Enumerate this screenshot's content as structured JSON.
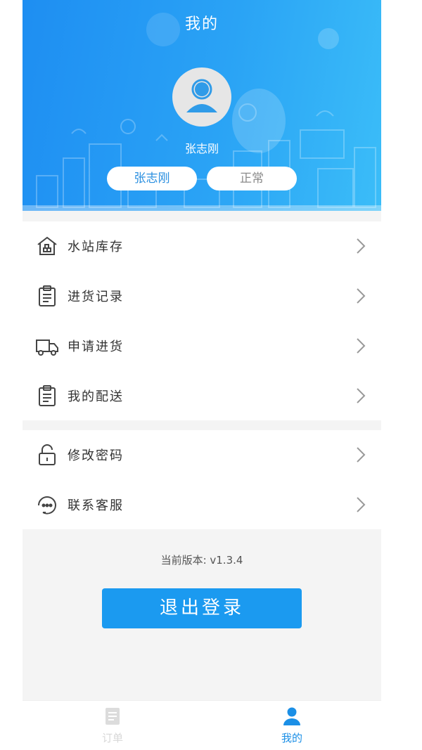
{
  "header": {
    "title": "我的",
    "username": "张志刚",
    "name_pill": "张志刚",
    "status_pill": "正常"
  },
  "menu": {
    "group1": [
      {
        "label": "水站库存",
        "icon": "warehouse-icon"
      },
      {
        "label": "进货记录",
        "icon": "clipboard-icon"
      },
      {
        "label": "申请进货",
        "icon": "truck-icon"
      },
      {
        "label": "我的配送",
        "icon": "clipboard-icon"
      }
    ],
    "group2": [
      {
        "label": "修改密码",
        "icon": "lock-icon"
      },
      {
        "label": "联系客服",
        "icon": "headset-icon"
      }
    ]
  },
  "version_text": "当前版本: v1.3.4",
  "logout_label": "退出登录",
  "tabbar": {
    "orders": "订单",
    "mine": "我的"
  },
  "colors": {
    "primary": "#1b9af0",
    "header_start": "#1e8ef2",
    "header_end": "#3bbdf8"
  }
}
